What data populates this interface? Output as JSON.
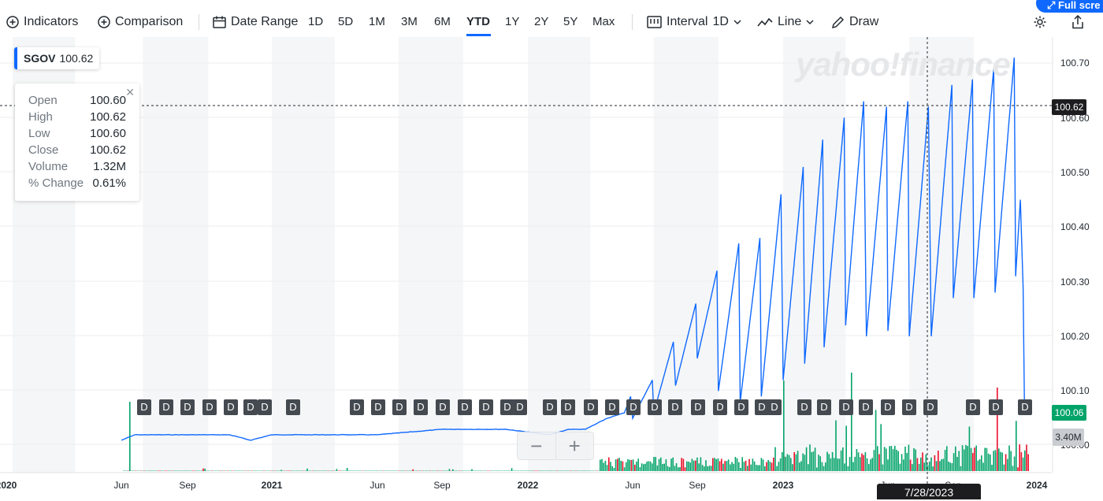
{
  "toolbar": {
    "indicators": "Indicators",
    "comparison": "Comparison",
    "date_range": "Date Range",
    "ranges": [
      "1D",
      "5D",
      "1M",
      "3M",
      "6M",
      "YTD",
      "1Y",
      "2Y",
      "5Y",
      "Max"
    ],
    "active_range": "YTD",
    "interval_label": "Interval",
    "interval_value": "1D",
    "chart_type": "Line",
    "draw": "Draw",
    "fullscreen": "Full scre"
  },
  "legend": {
    "symbol": "SGOV",
    "price": "100.62"
  },
  "tooltip": {
    "rows": [
      {
        "label": "Open",
        "value": "100.60"
      },
      {
        "label": "High",
        "value": "100.62"
      },
      {
        "label": "Low",
        "value": "100.60"
      },
      {
        "label": "Close",
        "value": "100.62"
      },
      {
        "label": "Volume",
        "value": "1.32M"
      },
      {
        "label": "% Change",
        "value": "0.61%"
      }
    ]
  },
  "watermark": "yahoo!finance",
  "y_axis": [
    "100.70",
    "100.60",
    "100.50",
    "100.40",
    "100.30",
    "100.20",
    "100.10",
    "100.00"
  ],
  "crosshair_price": "100.62",
  "last_price_badge": "100.06",
  "volume_badge": "3.40M",
  "x_axis": [
    "2020",
    "Jun",
    "Sep",
    "2021",
    "Jun",
    "Sep",
    "2022",
    "Jun",
    "Sep",
    "2023",
    "Jun",
    "Sep",
    "2024"
  ],
  "crosshair_date": "7/28/2023",
  "dividend_marker": "D",
  "zoom": {
    "minus": "−",
    "plus": "+"
  },
  "colors": {
    "line": "#0f69ff",
    "volume_up": "#03a46a",
    "volume_down": "#eb0f29",
    "accent": "#0f69ff"
  },
  "chart_data": {
    "type": "line",
    "symbol": "SGOV",
    "ylim": [
      99.98,
      100.74
    ],
    "series": [
      {
        "name": "SGOV",
        "points": [
          [
            "2020-06-01",
            100.01
          ],
          [
            "2020-06-20",
            100.02
          ],
          [
            "2020-08-01",
            100.02
          ],
          [
            "2020-09-01",
            100.02
          ],
          [
            "2020-10-01",
            100.02
          ],
          [
            "2020-11-01",
            100.02
          ],
          [
            "2020-12-01",
            100.01
          ],
          [
            "2021-01-01",
            100.02
          ],
          [
            "2021-03-01",
            100.02
          ],
          [
            "2021-06-01",
            100.02
          ],
          [
            "2021-09-01",
            100.03
          ],
          [
            "2021-12-01",
            100.03
          ],
          [
            "2022-02-01",
            100.02
          ],
          [
            "2022-03-01",
            100.03
          ],
          [
            "2022-03-25",
            100.03
          ],
          [
            "2022-04-25",
            100.05
          ],
          [
            "2022-05-20",
            100.06
          ],
          [
            "2022-05-29",
            100.09
          ],
          [
            "2022-06-01",
            100.05
          ],
          [
            "2022-06-29",
            100.12
          ],
          [
            "2022-07-01",
            100.06
          ],
          [
            "2022-07-29",
            100.19
          ],
          [
            "2022-08-01",
            100.11
          ],
          [
            "2022-08-30",
            100.26
          ],
          [
            "2022-09-01",
            100.16
          ],
          [
            "2022-09-29",
            100.32
          ],
          [
            "2022-10-01",
            100.1
          ],
          [
            "2022-10-30",
            100.37
          ],
          [
            "2022-11-01",
            100.08
          ],
          [
            "2022-11-29",
            100.38
          ],
          [
            "2022-12-01",
            100.09
          ],
          [
            "2022-12-29",
            100.46
          ],
          [
            "2023-01-01",
            100.12
          ],
          [
            "2023-01-30",
            100.51
          ],
          [
            "2023-02-01",
            100.15
          ],
          [
            "2023-02-27",
            100.56
          ],
          [
            "2023-03-01",
            100.18
          ],
          [
            "2023-03-30",
            100.6
          ],
          [
            "2023-04-01",
            100.22
          ],
          [
            "2023-04-27",
            100.63
          ],
          [
            "2023-05-01",
            100.2
          ],
          [
            "2023-05-30",
            100.62
          ],
          [
            "2023-06-01",
            100.21
          ],
          [
            "2023-06-29",
            100.63
          ],
          [
            "2023-07-01",
            100.2
          ],
          [
            "2023-07-28",
            100.62
          ],
          [
            "2023-08-01",
            100.2
          ],
          [
            "2023-08-30",
            100.66
          ],
          [
            "2023-09-01",
            100.27
          ],
          [
            "2023-09-29",
            100.67
          ],
          [
            "2023-10-01",
            100.27
          ],
          [
            "2023-10-30",
            100.69
          ],
          [
            "2023-11-01",
            100.28
          ],
          [
            "2023-11-29",
            100.71
          ],
          [
            "2023-12-01",
            100.31
          ],
          [
            "2023-12-08",
            100.45
          ],
          [
            "2023-12-12",
            100.29
          ],
          [
            "2023-12-14",
            100.06
          ]
        ]
      }
    ],
    "crosshair": {
      "date": "7/28/2023",
      "price": 100.62
    }
  }
}
